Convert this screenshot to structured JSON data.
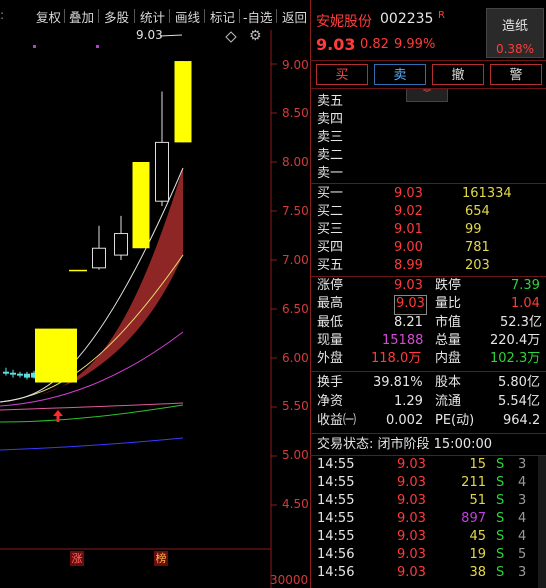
{
  "toolbar": {
    "items": [
      "复权",
      "叠加",
      "多股",
      "统计",
      "画线",
      "标记",
      "-自选",
      "返回"
    ]
  },
  "chart": {
    "price_axis": [
      "9.00",
      "8.50",
      "8.00",
      "7.50",
      "7.00",
      "6.50",
      "6.00",
      "5.50",
      "5.00",
      "4.50"
    ],
    "high_label": "9.03",
    "volume_label": "30000",
    "marker_zhang": "涨",
    "marker_bang": "榜"
  },
  "chart_data": {
    "type": "candlestick",
    "ylim": [
      4.3,
      9.05
    ],
    "candles": [
      {
        "open": 5.84,
        "close": 5.86,
        "high": 5.9,
        "low": 5.82
      },
      {
        "open": 5.85,
        "close": 5.83,
        "high": 5.88,
        "low": 5.8
      },
      {
        "open": 5.82,
        "close": 5.84,
        "high": 5.86,
        "low": 5.8
      },
      {
        "open": 5.84,
        "close": 5.8,
        "high": 5.86,
        "low": 5.78
      },
      {
        "open": 5.8,
        "close": 5.85,
        "high": 5.87,
        "low": 5.79
      },
      {
        "open": 5.88,
        "close": 5.86,
        "high": 5.89,
        "low": 5.85
      },
      {
        "open": 5.9,
        "close": 5.84,
        "high": 5.91,
        "low": 5.82
      },
      {
        "open": 5.88,
        "close": 5.85,
        "high": 5.9,
        "low": 5.83
      },
      {
        "open": 5.75,
        "close": 6.3,
        "high": 6.3,
        "low": 5.75
      },
      {
        "open": 6.9,
        "close": 6.9,
        "high": 6.9,
        "low": 6.9
      },
      {
        "open": 6.92,
        "close": 7.12,
        "high": 7.35,
        "low": 6.9
      },
      {
        "open": 7.05,
        "close": 7.27,
        "high": 7.45,
        "low": 7.0
      },
      {
        "open": 7.12,
        "close": 8.0,
        "high": 8.0,
        "low": 7.12
      },
      {
        "open": 7.6,
        "close": 8.2,
        "high": 8.72,
        "low": 7.55
      },
      {
        "open": 8.2,
        "close": 9.03,
        "high": 9.03,
        "low": 8.2
      }
    ]
  },
  "stock": {
    "name": "安妮股份",
    "code": "002235",
    "badge": "R",
    "price": "9.03",
    "change": "0.82",
    "change_pct": "9.99%",
    "sector": "造纸",
    "sector_pct": "0.38%"
  },
  "actions": {
    "buy": "买",
    "sell": "卖",
    "cancel": "撤",
    "alert": "警"
  },
  "asks": [
    {
      "label": "卖五",
      "price": "",
      "vol": ""
    },
    {
      "label": "卖四",
      "price": "",
      "vol": ""
    },
    {
      "label": "卖三",
      "price": "",
      "vol": ""
    },
    {
      "label": "卖二",
      "price": "",
      "vol": ""
    },
    {
      "label": "卖一",
      "price": "",
      "vol": ""
    }
  ],
  "bids": [
    {
      "label": "买一",
      "price": "9.03",
      "vol": "161334"
    },
    {
      "label": "买二",
      "price": "9.02",
      "vol": "654"
    },
    {
      "label": "买三",
      "price": "9.01",
      "vol": "99"
    },
    {
      "label": "买四",
      "price": "9.00",
      "vol": "781"
    },
    {
      "label": "买五",
      "price": "8.99",
      "vol": "203"
    }
  ],
  "stats": {
    "limit_up_label": "涨停",
    "limit_up": "9.03",
    "limit_down_label": "跌停",
    "limit_down": "7.39",
    "high_label": "最高",
    "high": "9.03",
    "vol_ratio_label": "量比",
    "vol_ratio": "1.04",
    "low_label": "最低",
    "low": "8.21",
    "mktcap_label": "市值",
    "mktcap": "52.3亿",
    "now_label": "现量",
    "now": "15188",
    "total_label": "总量",
    "total": "220.4万",
    "outer_label": "外盘",
    "outer": "118.0万",
    "inner_label": "内盘",
    "inner": "102.3万",
    "turnover_label": "换手",
    "turnover": "39.81%",
    "shares_label": "股本",
    "shares": "5.80亿",
    "nav_label": "净资",
    "nav": "1.29",
    "float_label": "流通",
    "float": "5.54亿",
    "eps_label": "收益㈠",
    "eps": "0.002",
    "pe_label": "PE(动)",
    "pe": "964.2"
  },
  "trade_status": "交易状态: 闭市阶段 15:00:00",
  "ticks": [
    {
      "time": "14:55",
      "price": "9.03",
      "vol": "15",
      "side": "S",
      "n": "3"
    },
    {
      "time": "14:55",
      "price": "9.03",
      "vol": "211",
      "side": "S",
      "n": "4"
    },
    {
      "time": "14:55",
      "price": "9.03",
      "vol": "51",
      "side": "S",
      "n": "3"
    },
    {
      "time": "14:55",
      "price": "9.03",
      "vol": "897",
      "side": "S",
      "n": "4"
    },
    {
      "time": "14:55",
      "price": "9.03",
      "vol": "45",
      "side": "S",
      "n": "4"
    },
    {
      "time": "14:56",
      "price": "9.03",
      "vol": "19",
      "side": "S",
      "n": "5"
    },
    {
      "time": "14:56",
      "price": "9.03",
      "vol": "38",
      "side": "S",
      "n": "3"
    }
  ]
}
